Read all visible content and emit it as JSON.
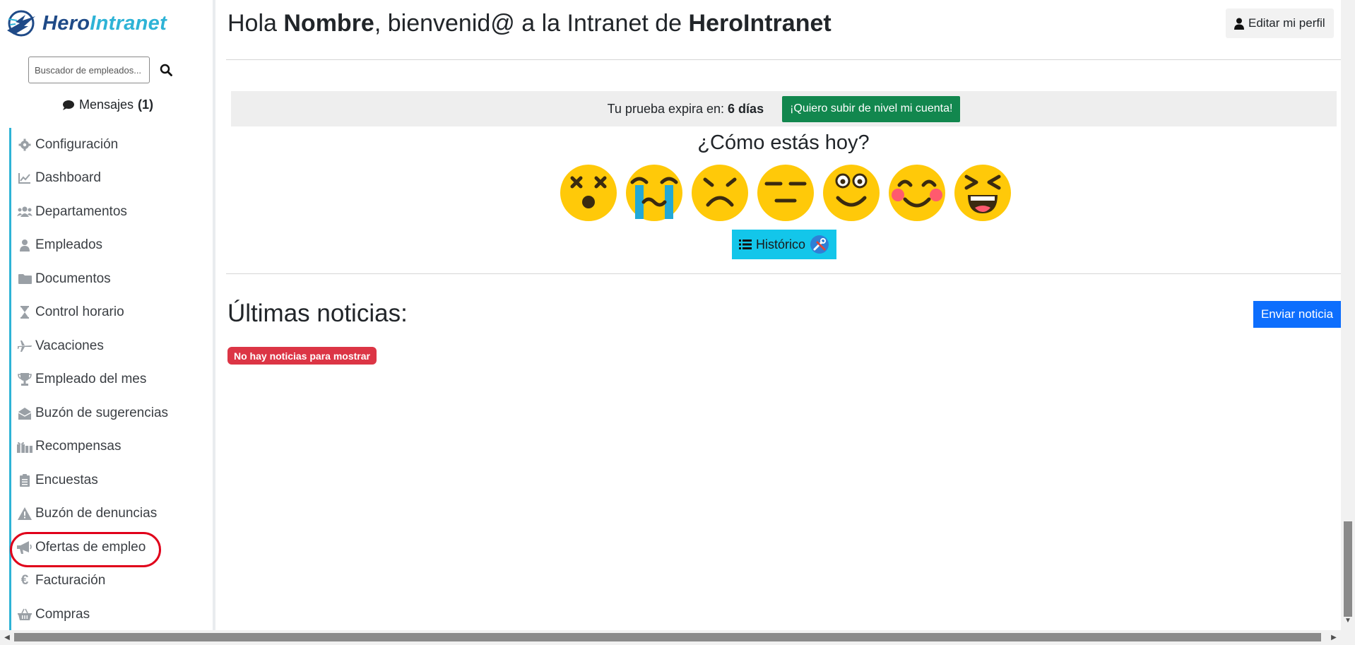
{
  "brand": {
    "part1": "Hero",
    "part2": "Intranet"
  },
  "search": {
    "placeholder": "Buscador de empleados..."
  },
  "messages": {
    "label": "Mensajes",
    "count": "(1)"
  },
  "sidebar": {
    "items": [
      {
        "label": "Configuración",
        "icon": "gear-icon"
      },
      {
        "label": "Dashboard",
        "icon": "chart-line-icon"
      },
      {
        "label": "Departamentos",
        "icon": "users-icon"
      },
      {
        "label": "Empleados",
        "icon": "user-icon"
      },
      {
        "label": "Documentos",
        "icon": "folder-icon"
      },
      {
        "label": "Control horario",
        "icon": "hourglass-icon"
      },
      {
        "label": "Vacaciones",
        "icon": "plane-icon"
      },
      {
        "label": "Empleado del mes",
        "icon": "trophy-icon"
      },
      {
        "label": "Buzón de sugerencias",
        "icon": "envelope-open-icon"
      },
      {
        "label": "Recompensas",
        "icon": "gifts-icon"
      },
      {
        "label": "Encuestas",
        "icon": "clipboard-list-icon"
      },
      {
        "label": "Buzón de denuncias",
        "icon": "warning-icon"
      },
      {
        "label": "Ofertas de empleo",
        "icon": "megaphone-icon"
      },
      {
        "label": "Facturación",
        "icon": "euro-icon"
      },
      {
        "label": "Compras",
        "icon": "basket-icon"
      }
    ]
  },
  "header": {
    "welcome_pre": "Hola ",
    "welcome_name": "Nombre",
    "welcome_mid": ", bienvenid@ a la Intranet de ",
    "welcome_brand": "HeroIntranet",
    "edit_profile": "Editar mi perfil"
  },
  "trial": {
    "text": "Tu prueba expira en:",
    "days": "6 días",
    "upgrade_label": "¡Quiero subir de nivel mi cuenta!",
    "upgrade_color": "#12874e"
  },
  "mood": {
    "title": "¿Cómo estás hoy?",
    "options": [
      "dizzy-face",
      "crying-face",
      "frowning-face",
      "expressionless-face",
      "slightly-smiling-face",
      "blushing-face",
      "laughing-face"
    ],
    "history_label": "Histórico"
  },
  "news": {
    "title": "Últimas noticias:",
    "send_label": "Enviar noticia",
    "empty_label": "No hay noticias para mostrar"
  },
  "colors": {
    "brand_dark": "#1f4a87",
    "brand_light": "#2eb3d6",
    "primary": "#0d6efd",
    "danger": "#dc3545",
    "info": "#13c6ea",
    "annotation": "#e0001a"
  }
}
